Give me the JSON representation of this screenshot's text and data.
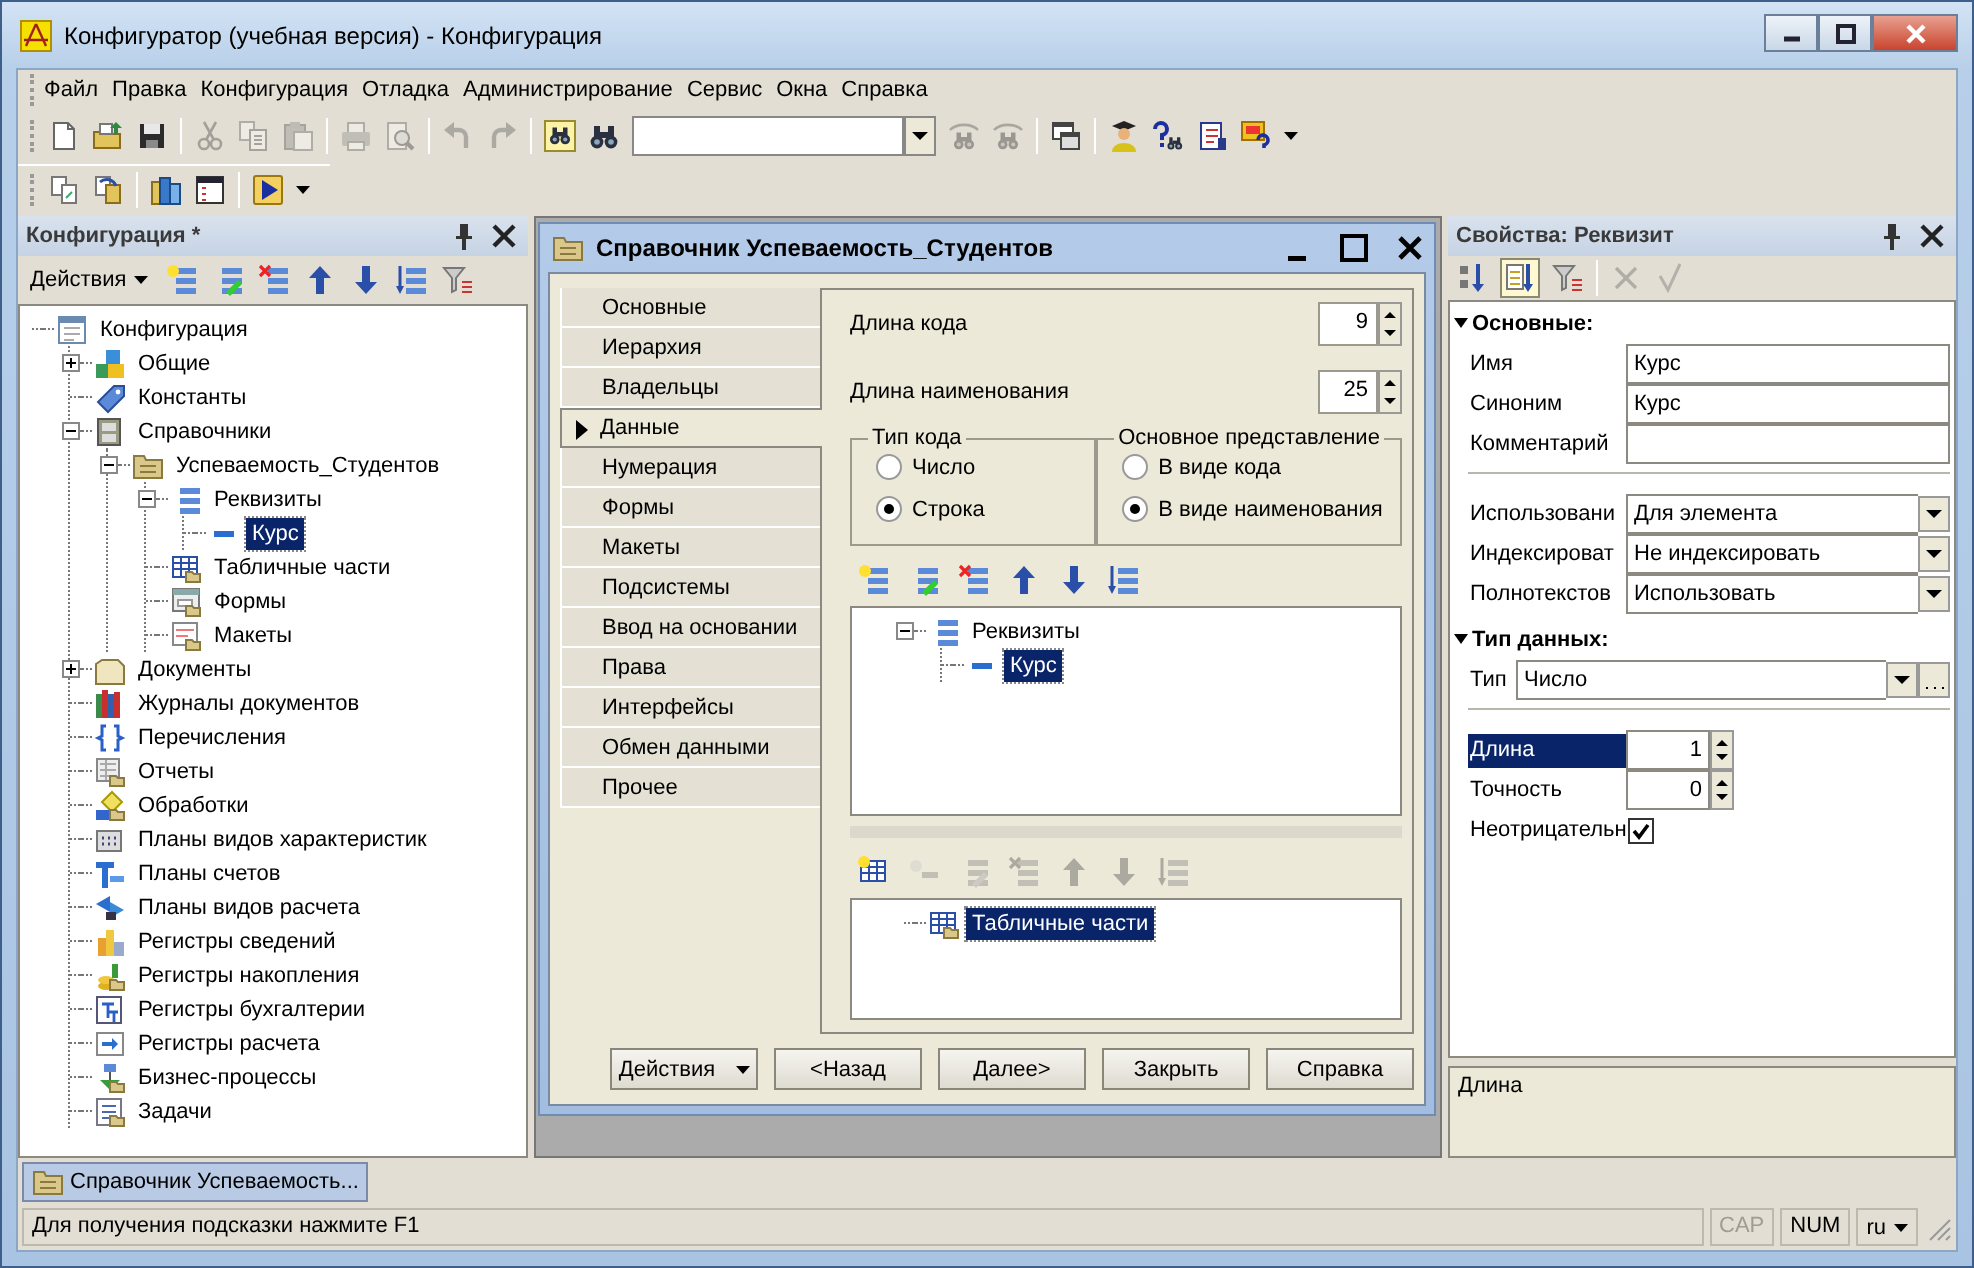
{
  "window": {
    "title": "Конфигуратор (учебная версия) - Конфигурация"
  },
  "menu": [
    "Файл",
    "Правка",
    "Конфигурация",
    "Отладка",
    "Администрирование",
    "Сервис",
    "Окна",
    "Справка"
  ],
  "toolbar_1": [
    {
      "disabled": false
    },
    {
      "disabled": false
    },
    {
      "disabled": false
    },
    {
      "disabled": true
    },
    {
      "disabled": true
    },
    {
      "disabled": true
    },
    {
      "disabled": true
    },
    {
      "disabled": true
    },
    {
      "disabled": true
    },
    {
      "disabled": true
    },
    {
      "disabled": false
    },
    {
      "disabled": false
    },
    {
      "disabled": true
    },
    {
      "disabled": true
    },
    {
      "disabled": false
    },
    {
      "disabled": false
    },
    {
      "disabled": false
    },
    {
      "disabled": false
    },
    {
      "disabled": false
    }
  ],
  "toolbar_2": [
    {
      "disabled": false
    },
    {
      "disabled": false
    },
    {
      "disabled": false
    },
    {
      "disabled": false
    },
    {
      "disabled": false
    }
  ],
  "config_panel": {
    "title": "Конфигурация *",
    "actions": "Действия",
    "toolbar": [
      {
        "disabled": false
      },
      {
        "disabled": false
      },
      {
        "disabled": false
      },
      {
        "disabled": false
      },
      {
        "disabled": false
      },
      {
        "disabled": false
      },
      {
        "disabled": false
      }
    ],
    "tree": [
      {
        "label": "Конфигурация",
        "selected": false,
        "children": [
          {
            "label": "Общие",
            "expanded": false,
            "selected": false
          },
          {
            "label": "Константы",
            "selected": false
          },
          {
            "label": "Справочники",
            "expanded": true,
            "selected": false,
            "children": [
              {
                "label": "Успеваемость_Студентов",
                "expanded": true,
                "selected": false,
                "children": [
                  {
                    "label": "Реквизиты",
                    "expanded": true,
                    "selected": false,
                    "children": [
                      {
                        "label": "Курс",
                        "selected": true
                      }
                    ]
                  },
                  {
                    "label": "Табличные части",
                    "selected": false
                  },
                  {
                    "label": "Формы",
                    "selected": false
                  },
                  {
                    "label": "Макеты",
                    "selected": false
                  }
                ]
              }
            ]
          },
          {
            "label": "Документы",
            "expanded": false,
            "selected": false
          },
          {
            "label": "Журналы документов",
            "selected": false
          },
          {
            "label": "Перечисления",
            "selected": false
          },
          {
            "label": "Отчеты",
            "selected": false
          },
          {
            "label": "Обработки",
            "selected": false
          },
          {
            "label": "Планы видов характеристик",
            "selected": false
          },
          {
            "label": "Планы счетов",
            "selected": false
          },
          {
            "label": "Планы видов расчета",
            "selected": false
          },
          {
            "label": "Регистры сведений",
            "selected": false
          },
          {
            "label": "Регистры накопления",
            "selected": false
          },
          {
            "label": "Регистры бухгалтерии",
            "selected": false
          },
          {
            "label": "Регистры расчета",
            "selected": false
          },
          {
            "label": "Бизнес-процессы",
            "selected": false
          },
          {
            "label": "Задачи",
            "selected": false
          }
        ]
      }
    ]
  },
  "dialog": {
    "title": "Справочник Успеваемость_Студентов",
    "tabs": [
      {
        "label": "Основные",
        "selected": false
      },
      {
        "label": "Иерархия",
        "selected": false
      },
      {
        "label": "Владельцы",
        "selected": false
      },
      {
        "label": "Данные",
        "selected": true
      },
      {
        "label": "Нумерация",
        "selected": false
      },
      {
        "label": "Формы",
        "selected": false
      },
      {
        "label": "Макеты",
        "selected": false
      },
      {
        "label": "Подсистемы",
        "selected": false
      },
      {
        "label": "Ввод на основании",
        "selected": false
      },
      {
        "label": "Права",
        "selected": false
      },
      {
        "label": "Интерфейсы",
        "selected": false
      },
      {
        "label": "Обмен данными",
        "selected": false
      },
      {
        "label": "Прочее",
        "selected": false
      }
    ],
    "code_length": {
      "label": "Длина кода",
      "value": "9"
    },
    "name_length": {
      "label": "Длина наименования",
      "value": "25"
    },
    "code_type": {
      "title": "Тип кода",
      "options": [
        {
          "label": "Число",
          "selected": false
        },
        {
          "label": "Строка",
          "selected": true
        }
      ]
    },
    "main_presentation": {
      "title": "Основное представление",
      "options": [
        {
          "label": "В виде кода",
          "selected": false
        },
        {
          "label": "В виде наименования",
          "selected": true
        }
      ]
    },
    "attributes_toolbar": [
      {
        "disabled": false
      },
      {
        "disabled": false
      },
      {
        "disabled": false
      },
      {
        "disabled": false
      },
      {
        "disabled": false
      },
      {
        "disabled": false
      }
    ],
    "attributes_tree": [
      {
        "label": "Реквизиты",
        "expanded": true,
        "selected": false,
        "children": [
          {
            "label": "Курс",
            "selected": true
          }
        ]
      }
    ],
    "tabular_toolbar": [
      {
        "disabled": false
      },
      {
        "disabled": true
      },
      {
        "disabled": true
      },
      {
        "disabled": true
      },
      {
        "disabled": true
      },
      {
        "disabled": true
      },
      {
        "disabled": true
      }
    ],
    "tabular_tree": [
      {
        "label": "Табличные части",
        "selected": true
      }
    ],
    "buttons": [
      {
        "label": "Действия",
        "kind": "menu"
      },
      {
        "label": "<Назад",
        "kind": "plain"
      },
      {
        "label": "Далее>",
        "kind": "plain"
      },
      {
        "label": "Закрыть",
        "kind": "plain"
      },
      {
        "label": "Справка",
        "kind": "plain"
      }
    ]
  },
  "properties": {
    "title": "Свойства: Реквизит",
    "toolbar": [
      {
        "disabled": false,
        "pressed": false
      },
      {
        "disabled": false,
        "pressed": true
      },
      {
        "disabled": false,
        "pressed": false
      },
      {
        "disabled": true,
        "pressed": false
      },
      {
        "disabled": true,
        "pressed": false
      }
    ],
    "sections": [
      {
        "title": "Основные:",
        "expanded": true,
        "groups": [
          [
            {
              "kind": "text",
              "label": "Имя",
              "value": "Курс",
              "selected": false
            },
            {
              "kind": "text",
              "label": "Синоним",
              "value": "Курс",
              "selected": false
            },
            {
              "kind": "text",
              "label": "Комментарий",
              "selected": false
            }
          ],
          [
            {
              "kind": "select",
              "label": "Использовани",
              "value": "Для элемента",
              "selected": false
            },
            {
              "kind": "select",
              "label": "Индексироват",
              "value": "Не индексировать",
              "selected": false
            },
            {
              "kind": "select",
              "label": "Полнотекстов",
              "value": "Использовать",
              "selected": false
            }
          ]
        ]
      },
      {
        "title": "Тип данных:",
        "expanded": true,
        "groups": [
          [
            {
              "kind": "type",
              "label": "Тип",
              "value": "Число",
              "selected": false
            }
          ],
          [
            {
              "kind": "number",
              "label": "Длина",
              "value": "1",
              "selected": true
            },
            {
              "kind": "number",
              "label": "Точность",
              "value": "0",
              "selected": false
            },
            {
              "kind": "check",
              "label": "Неотрицательн",
              "checked": true,
              "selected": false
            }
          ]
        ]
      }
    ],
    "description": "Длина"
  },
  "taskbar": [
    {
      "label": "Справочник Успеваемость...",
      "selected": true
    }
  ],
  "status_bar": {
    "text": "Для получения подсказки нажмите F1",
    "indicators": [
      {
        "label": "CAP",
        "on": false
      },
      {
        "label": "NUM",
        "on": true
      }
    ],
    "language": "ru"
  }
}
